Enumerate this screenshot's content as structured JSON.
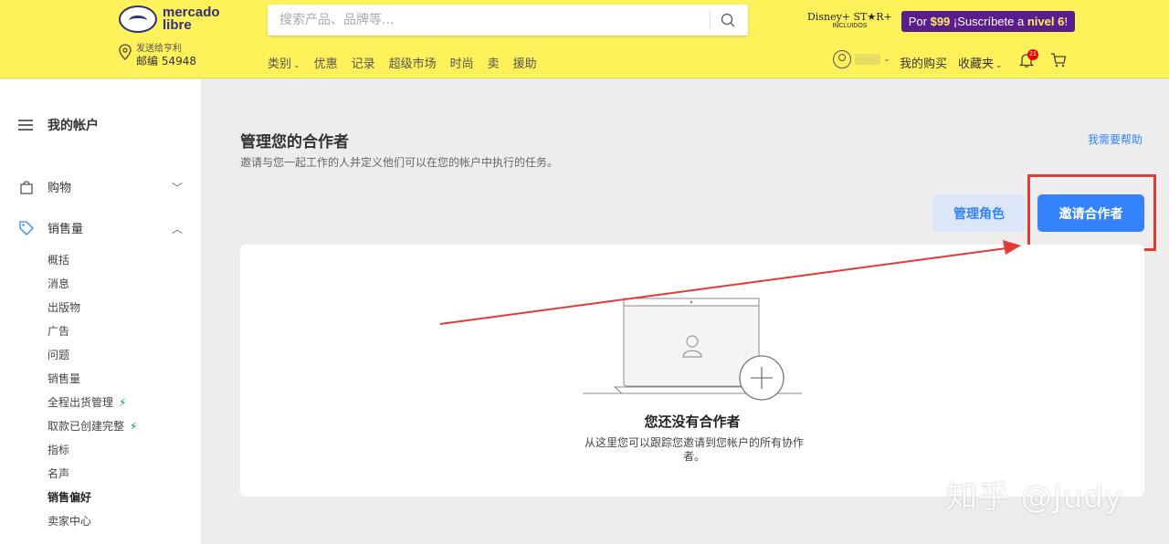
{
  "header": {
    "logo_line1": "mercado",
    "logo_line2": "libre",
    "ship_label": "发送给亨利",
    "ship_zip": "邮编 54948",
    "search_placeholder": "搜索产品、品牌等...",
    "nav": [
      "类别",
      "优惠",
      "记录",
      "超级市场",
      "时尚",
      "卖",
      "援助"
    ],
    "disney_line1": "Disney+ ST★R+",
    "disney_line2": "INCLUIDOS",
    "promo_prefix": "Por ",
    "promo_price": "$99",
    "promo_mid": " ¡Suscríbete a ",
    "promo_level": "nivel 6",
    "promo_suffix": "!",
    "my_purchases": "我的购买",
    "favorites": "收藏夹",
    "notifications_count": "21"
  },
  "sidebar": {
    "title": "我的帐户",
    "sections": [
      {
        "label": "购物",
        "expanded": false
      },
      {
        "label": "销售量",
        "expanded": true
      }
    ],
    "items": [
      {
        "label": "概括",
        "bolt": false
      },
      {
        "label": "消息",
        "bolt": false
      },
      {
        "label": "出版物",
        "bolt": false
      },
      {
        "label": "广告",
        "bolt": false
      },
      {
        "label": "问题",
        "bolt": false
      },
      {
        "label": "销售量",
        "bolt": false
      },
      {
        "label": "全程出货管理",
        "bolt": true
      },
      {
        "label": "取款已创建完整",
        "bolt": true
      },
      {
        "label": "指标",
        "bolt": false
      },
      {
        "label": "名声",
        "bolt": false
      },
      {
        "label": "销售偏好",
        "bolt": false,
        "active": true
      },
      {
        "label": "卖家中心",
        "bolt": false
      }
    ]
  },
  "main": {
    "title": "管理您的合作者",
    "subtitle": "邀请与您一起工作的人并定义他们可以在您的帐户中执行的任务。",
    "help": "我需要帮助",
    "manage_roles": "管理角色",
    "invite": "邀请合作者",
    "empty_title": "您还没有合作者",
    "empty_desc": "从这里您可以跟踪您邀请到您帐户的所有协作者。"
  },
  "watermark": "知乎 @Judy",
  "colors": {
    "header_bg": "#fff159",
    "primary": "#3483fa",
    "highlight": "#e53935",
    "promo_bg": "#5a1e8c",
    "bolt": "#00a650"
  }
}
